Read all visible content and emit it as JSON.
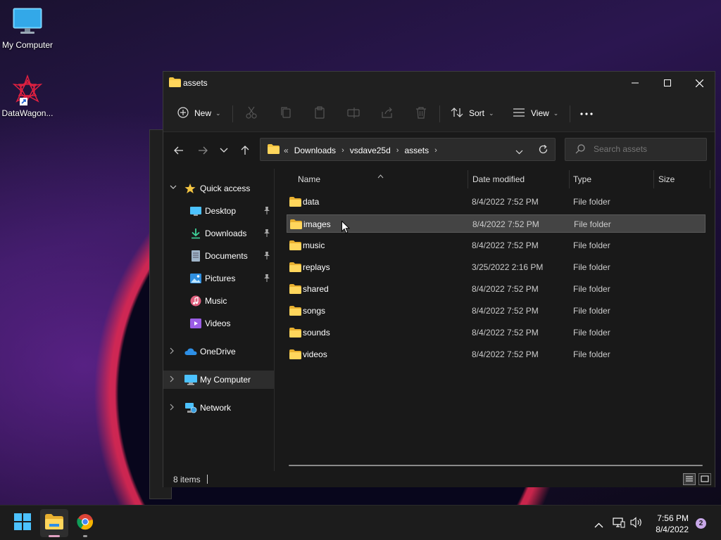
{
  "desktop": {
    "icons": [
      {
        "label": "My Computer"
      },
      {
        "label": "DataWagon..."
      }
    ]
  },
  "window": {
    "title": "assets",
    "commands": {
      "new_label": "New",
      "sort_label": "Sort",
      "view_label": "View"
    },
    "address": {
      "overflow": "«",
      "crumbs": [
        "Downloads",
        "vsdave25d",
        "assets"
      ]
    },
    "search": {
      "placeholder": "Search assets"
    },
    "nav": {
      "quick_access": "Quick access",
      "items": [
        {
          "label": "Desktop",
          "pinned": true
        },
        {
          "label": "Downloads",
          "pinned": true
        },
        {
          "label": "Documents",
          "pinned": true
        },
        {
          "label": "Pictures",
          "pinned": true
        },
        {
          "label": "Music",
          "pinned": false
        },
        {
          "label": "Videos",
          "pinned": false
        }
      ],
      "onedrive": "OneDrive",
      "my_computer": "My Computer",
      "network": "Network"
    },
    "columns": {
      "name": "Name",
      "date": "Date modified",
      "type": "Type",
      "size": "Size"
    },
    "files": [
      {
        "name": "data",
        "date": "8/4/2022 7:52 PM",
        "type": "File folder"
      },
      {
        "name": "images",
        "date": "8/4/2022 7:52 PM",
        "type": "File folder"
      },
      {
        "name": "music",
        "date": "8/4/2022 7:52 PM",
        "type": "File folder"
      },
      {
        "name": "replays",
        "date": "3/25/2022 2:16 PM",
        "type": "File folder"
      },
      {
        "name": "shared",
        "date": "8/4/2022 7:52 PM",
        "type": "File folder"
      },
      {
        "name": "songs",
        "date": "8/4/2022 7:52 PM",
        "type": "File folder"
      },
      {
        "name": "sounds",
        "date": "8/4/2022 7:52 PM",
        "type": "File folder"
      },
      {
        "name": "videos",
        "date": "8/4/2022 7:52 PM",
        "type": "File folder"
      }
    ],
    "selected_index": 1,
    "status": {
      "count": "8 items"
    }
  },
  "taskbar": {
    "time": "7:56 PM",
    "date": "8/4/2022",
    "notification_count": "2"
  },
  "colors": {
    "folder": "#f4c542",
    "accent": "#4cc2ff",
    "window_bg": "#191919"
  }
}
